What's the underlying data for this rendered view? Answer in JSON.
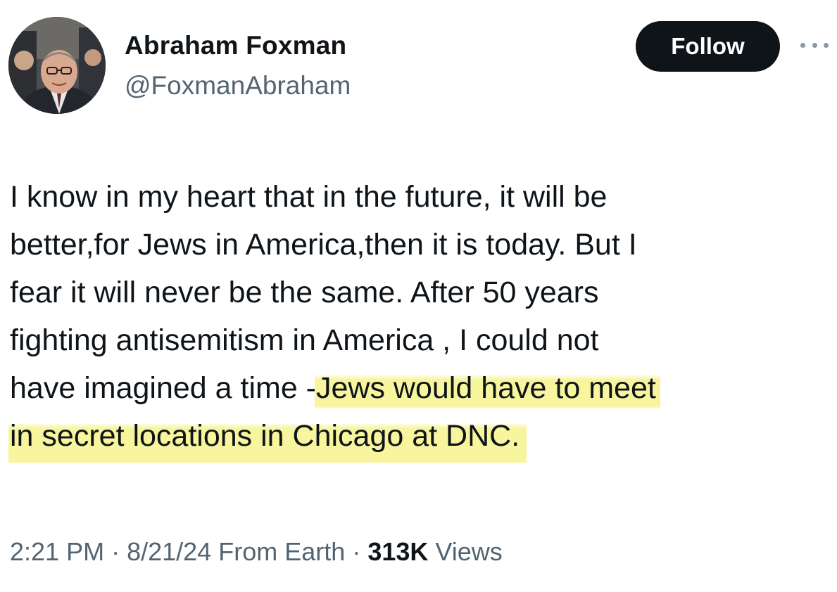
{
  "author": {
    "display_name": "Abraham Foxman",
    "handle": "@FoxmanAbraham"
  },
  "actions": {
    "follow_label": "Follow"
  },
  "tweet": {
    "lines": [
      "I know in my heart that in the future, it will be",
      "better,for Jews in America,then  it is today. But I",
      "fear it will never be the same. After 50 years",
      "fighting antisemitism in America , I could not"
    ],
    "line5_plain": "have imagined a time -",
    "line5_highlight": "Jews would have to meet",
    "line6_highlight": "in secret locations in Chicago at DNC."
  },
  "meta": {
    "time": "2:21 PM",
    "separator": "·",
    "date": "8/21/24",
    "location": "From Earth",
    "views_count": "313K",
    "views_label": "Views"
  },
  "colors": {
    "text_primary": "#0f1419",
    "text_secondary": "#536471",
    "follow_bg": "#0f1419",
    "highlight": "#f6f38c"
  }
}
